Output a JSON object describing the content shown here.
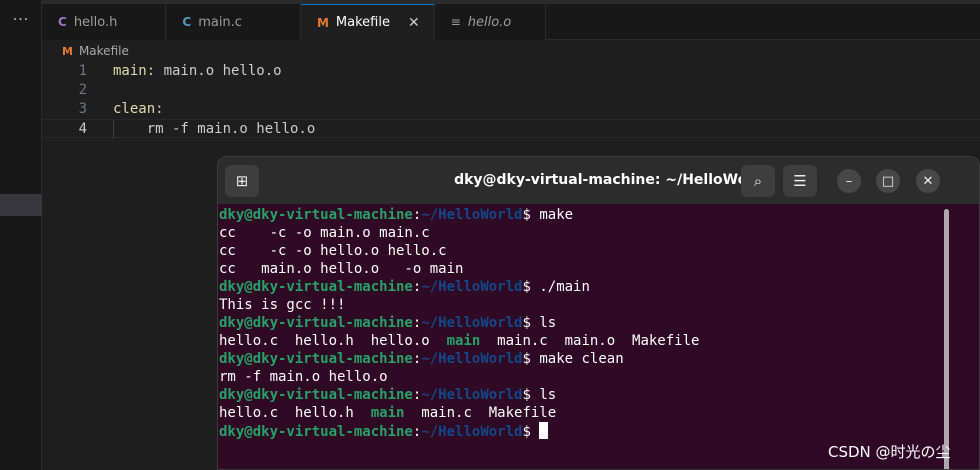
{
  "activity": {
    "more_label": "···"
  },
  "tabs": [
    {
      "icon": "C",
      "label": "hello.h",
      "italic": false
    },
    {
      "icon": "C",
      "label": "main.c",
      "italic": false
    },
    {
      "icon": "M",
      "label": "Makefile",
      "italic": false,
      "active": true,
      "close": "✕"
    },
    {
      "icon": "≡",
      "label": "hello.o",
      "italic": true
    }
  ],
  "breadcrumb": {
    "icon": "M",
    "label": "Makefile"
  },
  "editor": {
    "lines": [
      {
        "num": "1",
        "target": "main",
        "rest": ": main.o hello.o"
      },
      {
        "num": "2",
        "target": "",
        "rest": ""
      },
      {
        "num": "3",
        "target": "clean",
        "rest": ":"
      },
      {
        "num": "4",
        "target": "",
        "rest": "    rm -f main.o hello.o"
      }
    ]
  },
  "terminal": {
    "title": "dky@dky-virtual-machine: ~/HelloWorld",
    "new_tab_icon": "⊞",
    "search_icon": "⌕",
    "menu_icon": "☰",
    "minimize_icon": "–",
    "maximize_icon": "□",
    "close_icon": "✕",
    "prompt_user": "dky@dky-virtual-machine",
    "prompt_sep": ":",
    "prompt_path": "~/HelloWorld",
    "prompt_dollar": "$",
    "cmd1": " make",
    "out1": "cc    -c -o main.o main.c",
    "out2": "cc    -c -o hello.o hello.c",
    "out3": "cc   main.o hello.o   -o main",
    "cmd2": " ./main",
    "out4": "This is gcc !!!",
    "cmd3": " ls",
    "ls1_a": "hello.c  hello.h  hello.o  ",
    "ls1_exe": "main",
    "ls1_b": "  main.c  main.o  Makefile",
    "cmd4": " make clean",
    "out5": "rm -f main.o hello.o",
    "cmd5": " ls",
    "ls2_a": "hello.c  hello.h  ",
    "ls2_exe": "main",
    "ls2_b": "  main.c  Makefile"
  },
  "watermark": "CSDN @时光の尘",
  "colors": {
    "terminal_bg": "#300a24",
    "prompt_user": "#26a269",
    "prompt_path": "#12488b",
    "accent": "#0078d4"
  }
}
